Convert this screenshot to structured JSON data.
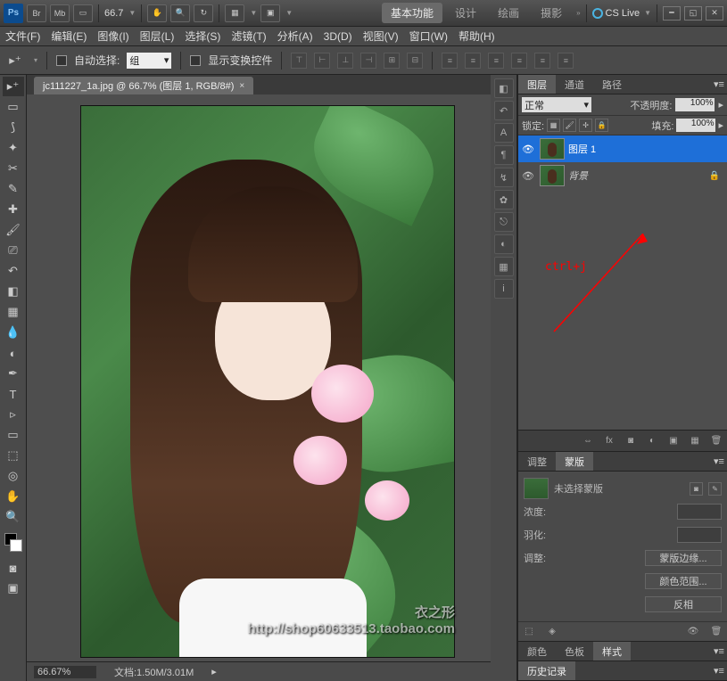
{
  "topbar": {
    "zoom": "66.7",
    "workspaces": [
      "基本功能",
      "设计",
      "绘画",
      "摄影"
    ],
    "cslive": "CS Live"
  },
  "menu": [
    "文件(F)",
    "编辑(E)",
    "图像(I)",
    "图层(L)",
    "选择(S)",
    "滤镜(T)",
    "分析(A)",
    "3D(D)",
    "视图(V)",
    "窗口(W)",
    "帮助(H)"
  ],
  "optbar": {
    "auto_select": "自动选择:",
    "group": "组",
    "show_transform": "显示变换控件"
  },
  "doc_tab": "jc111227_1a.jpg @ 66.7% (图层 1, RGB/8#)",
  "panels": {
    "layer_tabs": [
      "图层",
      "通道",
      "路径"
    ],
    "blend_mode": "正常",
    "opacity_label": "不透明度:",
    "opacity_value": "100%",
    "lock_label": "锁定:",
    "fill_label": "填充:",
    "fill_value": "100%",
    "layers": [
      {
        "name": "图层 1",
        "selected": true,
        "locked": false
      },
      {
        "name": "背景",
        "selected": false,
        "locked": true,
        "italic": true
      }
    ],
    "annotation": "ctrl+j",
    "adj_tabs": [
      "调整",
      "蒙版"
    ],
    "mask_unselected": "未选择蒙版",
    "density": "浓度:",
    "feather": "羽化:",
    "adjust_label": "调整:",
    "mask_edge": "蒙版边缘...",
    "color_range": "颜色范围...",
    "invert": "反相",
    "hist_tabs": [
      "颜色",
      "色板",
      "样式"
    ],
    "history": "历史记录"
  },
  "status": {
    "zoom": "66.67%",
    "doc_size": "文档:1.50M/3.01M"
  },
  "watermark": {
    "line1": "衣之形",
    "line2": "http://shop60633513.taobao.com"
  }
}
